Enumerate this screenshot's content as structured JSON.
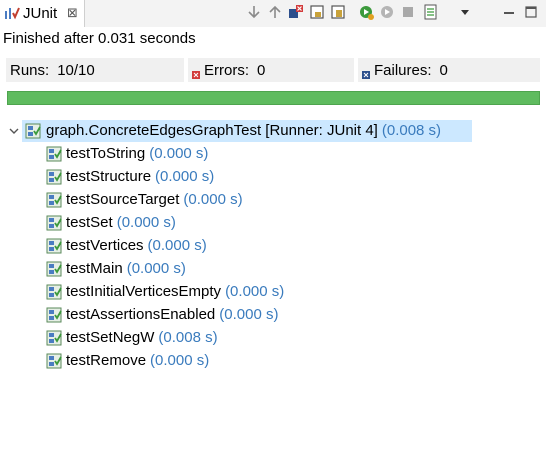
{
  "tab": {
    "label": "JUnit",
    "close_glyph": "⊠"
  },
  "toolbar_icons": [
    "next-failure-icon",
    "previous-failure-icon",
    "show-failures-only-icon",
    "scroll-lock-icon",
    "layout-toggle-icon",
    "rerun-test-icon",
    "rerun-failed-first-icon",
    "stop-icon",
    "test-run-history-icon",
    "view-menu-icon",
    "minimize-icon",
    "maximize-icon"
  ],
  "status": "Finished after 0.031 seconds",
  "counters": {
    "runs_label": "Runs:",
    "runs_value": "10/10",
    "errors_label": "Errors:",
    "errors_value": "0",
    "failures_label": "Failures:",
    "failures_value": "0"
  },
  "progress": {
    "fraction": 1.0,
    "color": "#5fbb5f"
  },
  "tree": {
    "suite": {
      "name": "graph.ConcreteEdgesGraphTest [Runner: JUnit 4]",
      "time": "(0.008 s)"
    },
    "tests": [
      {
        "name": "testToString",
        "time": "(0.000 s)"
      },
      {
        "name": "testStructure",
        "time": "(0.000 s)"
      },
      {
        "name": "testSourceTarget",
        "time": "(0.000 s)"
      },
      {
        "name": "testSet",
        "time": "(0.000 s)"
      },
      {
        "name": "testVertices",
        "time": "(0.000 s)"
      },
      {
        "name": "testMain",
        "time": "(0.000 s)"
      },
      {
        "name": "testInitialVerticesEmpty",
        "time": "(0.000 s)"
      },
      {
        "name": "testAssertionsEnabled",
        "time": "(0.000 s)"
      },
      {
        "name": "testSetNegW",
        "time": "(0.008 s)"
      },
      {
        "name": "testRemove",
        "time": "(0.000 s)"
      }
    ]
  },
  "colors": {
    "time_text": "#3a7bbd",
    "selection": "#cce8ff",
    "pass_green": "#3c9a3c"
  }
}
